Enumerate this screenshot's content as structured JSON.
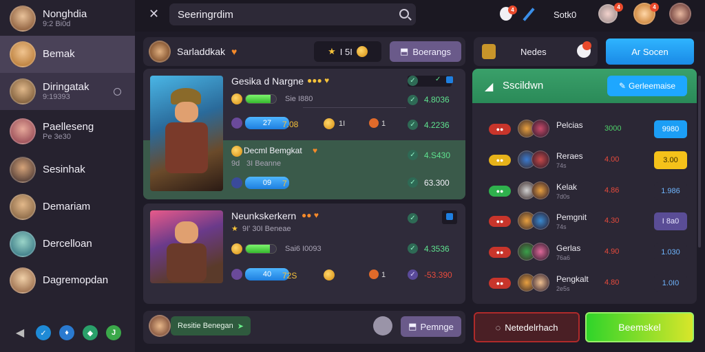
{
  "user": {
    "name": "Nonghdia",
    "sub": "9:2 Bi0d"
  },
  "sidebar": {
    "items": [
      {
        "label": "Bemak",
        "sub": ""
      },
      {
        "label": "Diringatak",
        "sub": "9:19393"
      },
      {
        "label": "Paelleseng",
        "sub": "Pe 3e30"
      },
      {
        "label": "Sesinhak",
        "sub": ""
      },
      {
        "label": "Demariam",
        "sub": ""
      },
      {
        "label": "Dercelloan",
        "sub": ""
      },
      {
        "label": "Dagremopdan",
        "sub": ""
      }
    ]
  },
  "topbar": {
    "search_value": "Seeringrdim",
    "label": "Sotk0",
    "badge1": "4",
    "badge2": "4",
    "badge3": "4"
  },
  "header": {
    "title": "Sarladdkak",
    "coins": "I 5I",
    "button": "Boerangs"
  },
  "card1": {
    "title": "Gesika d Nargne",
    "stat": "Sie I880",
    "blue_bar": "27",
    "val1": "7.08",
    "val2": "1I",
    "val3": "1",
    "sub_title": "Decml Bemgkat",
    "sub_line1": "9d",
    "sub_line2": "3I Beanne",
    "blue_bar2": "09",
    "val4": "7",
    "list": [
      "4.8036",
      "4.2236",
      "4.S430",
      "63.300"
    ]
  },
  "card2": {
    "title": "Neunkskerkern",
    "sub": "9I' 30I Beneae",
    "stat": "Sai6 I0093",
    "blue_bar": "40",
    "val1": "72S",
    "val3": "1",
    "list": [
      "4.3536",
      "-53.390"
    ]
  },
  "footer_left": {
    "label": "Resitie Benegan",
    "button": "Pemnge"
  },
  "right": {
    "tab_label": "Nedes",
    "button": "Ar Socen",
    "banner_title": "Sscildwn",
    "banner_btn": "Gerleemaise",
    "rows": [
      {
        "name": "Pelcias",
        "sub": "",
        "val": "3000",
        "btn": "9980",
        "val_color": "#4fd36a",
        "btn_color": "#1c9ef5",
        "btn_text": "#ffffff",
        "tog_color": "#c8352b"
      },
      {
        "name": "Reraes",
        "sub": "74s",
        "val": "4.00",
        "btn": "3.00",
        "val_color": "#e84b3c",
        "btn_color": "#f5c21a",
        "btn_text": "#3a2a00",
        "tog_color": "#e6b21a"
      },
      {
        "name": "Kelak",
        "sub": "7d0s",
        "val": "4.86",
        "btn": "1.986",
        "val_color": "#e84b3c",
        "btn_color": "#2b2735",
        "btn_text": "#6fb6ff",
        "tog_color": "#2fb14d"
      },
      {
        "name": "Pemgnit",
        "sub": "74s",
        "val": "4.30",
        "btn": "I 8a0",
        "val_color": "#e84b3c",
        "btn_color": "#5a4d96",
        "btn_text": "#e8e6ff",
        "tog_color": "#c8352b"
      },
      {
        "name": "Gerlas",
        "sub": "76a6",
        "val": "4.90",
        "btn": "1.030",
        "val_color": "#e84b3c",
        "btn_color": "#2b2735",
        "btn_text": "#6fb6ff",
        "tog_color": "#c8352b"
      },
      {
        "name": "Pengkalt",
        "sub": "2e5s",
        "val": "4.80",
        "btn": "1.0I0",
        "val_color": "#e84b3c",
        "btn_color": "#2b2735",
        "btn_text": "#6fb6ff",
        "tog_color": "#c8352b"
      }
    ],
    "footer_btn1": "Netedelrhach",
    "footer_btn2": "Beemskel"
  },
  "colors": {
    "accent_green": "#38c96a",
    "accent_blue": "#1ea7ff",
    "sidebar_active": "#4a4258"
  }
}
